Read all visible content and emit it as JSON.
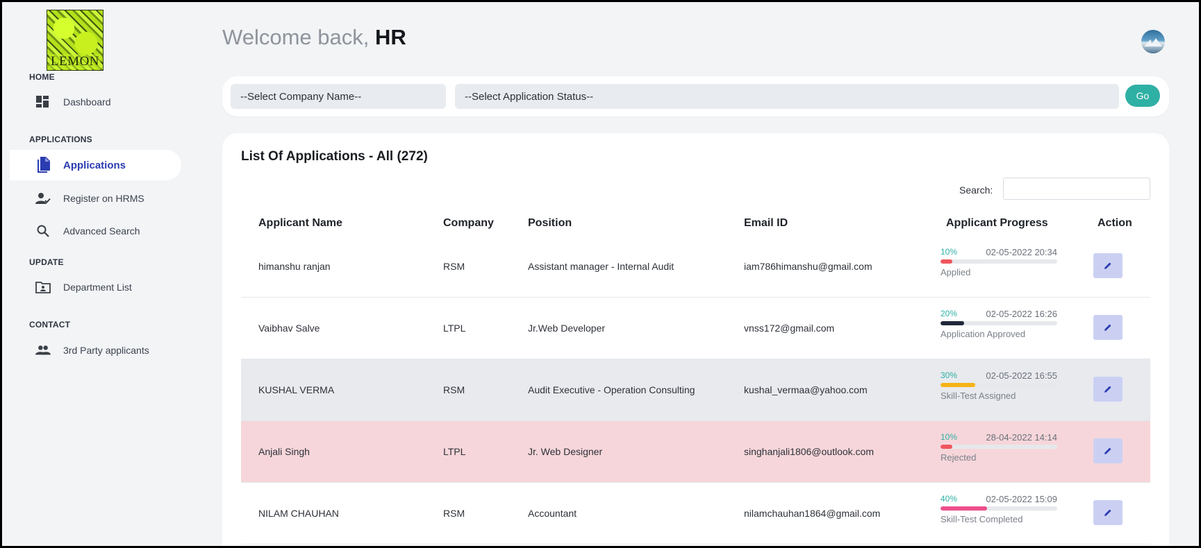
{
  "logo": {
    "text": "LEMON"
  },
  "sidebar": {
    "sections": [
      {
        "label": "HOME"
      },
      {
        "label": "APPLICATIONS"
      },
      {
        "label": "UPDATE"
      },
      {
        "label": "CONTACT"
      }
    ],
    "items": [
      {
        "label": "Dashboard",
        "icon": "dashboard-icon"
      },
      {
        "label": "Applications",
        "icon": "document-icon",
        "active": true
      },
      {
        "label": "Register on HRMS",
        "icon": "user-check-icon"
      },
      {
        "label": "Advanced Search",
        "icon": "search-icon"
      },
      {
        "label": "Department List",
        "icon": "folder-user-icon"
      },
      {
        "label": "3rd Party applicants",
        "icon": "group-icon"
      }
    ]
  },
  "header": {
    "welcome_prefix": "Welcome back,",
    "user": "HR"
  },
  "filters": {
    "company_placeholder": "--Select Company Name--",
    "status_placeholder": "--Select Application Status--",
    "go_label": "Go"
  },
  "table": {
    "title": "List Of Applications - All (272)",
    "search_label": "Search:",
    "search_value": "",
    "columns": [
      "Applicant Name",
      "Company",
      "Position",
      "Email ID",
      "Applicant Progress",
      "Action"
    ],
    "rows": [
      {
        "name": "himanshu ranjan",
        "company": "RSM",
        "position": "Assistant manager - Internal Audit",
        "email": "iam786himanshu@gmail.com",
        "progress_pct": "10%",
        "progress": 10,
        "datetime": "02-05-2022 20:34",
        "status": "Applied",
        "bar_color": "#f0555d",
        "highlight": "none"
      },
      {
        "name": "Vaibhav Salve",
        "company": "LTPL",
        "position": "Jr.Web Developer",
        "email": "vnss172@gmail.com",
        "progress_pct": "20%",
        "progress": 20,
        "datetime": "02-05-2022 16:26",
        "status": "Application Approved",
        "bar_color": "#1f2838",
        "highlight": "none"
      },
      {
        "name": "KUSHAL VERMA",
        "company": "RSM",
        "position": "Audit Executive - Operation Consulting",
        "email": "kushal_vermaa@yahoo.com",
        "progress_pct": "30%",
        "progress": 30,
        "datetime": "02-05-2022 16:55",
        "status": "Skill-Test Assigned",
        "bar_color": "#f5b316",
        "highlight": "grey"
      },
      {
        "name": "Anjali Singh",
        "company": "LTPL",
        "position": "Jr. Web Designer",
        "email": "singhanjali1806@outlook.com",
        "progress_pct": "10%",
        "progress": 10,
        "datetime": "28-04-2022 14:14",
        "status": "Rejected",
        "bar_color": "#f0555d",
        "highlight": "pink"
      },
      {
        "name": "NILAM CHAUHAN",
        "company": "RSM",
        "position": "Accountant",
        "email": "nilamchauhan1864@gmail.com",
        "progress_pct": "40%",
        "progress": 40,
        "datetime": "02-05-2022 15:09",
        "status": "Skill-Test Completed",
        "bar_color": "#ec4f8a",
        "highlight": "none"
      }
    ]
  },
  "colors": {
    "accent": "#2fb0a4",
    "active_nav": "#2a3cb0",
    "edit_button": "#cbd0f3",
    "edit_icon": "#2a3cb0"
  }
}
